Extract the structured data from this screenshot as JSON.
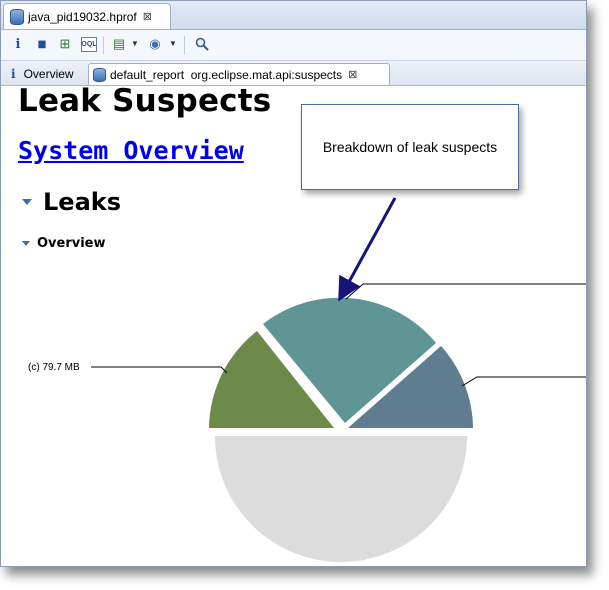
{
  "editor_tab": {
    "label": "java_pid19032.hprof",
    "close_glyph": "⊠"
  },
  "toolbar": {
    "buttons": [
      {
        "icon": "info-icon",
        "glyph": "i"
      },
      {
        "icon": "histogram-icon",
        "glyph": "▮▮"
      },
      {
        "icon": "dominator-tree-icon",
        "glyph": "⊞"
      },
      {
        "icon": "oql-icon",
        "glyph": "OQL"
      },
      {
        "icon": "run-report-icon",
        "glyph": "▤"
      },
      {
        "icon": "query-browser-icon",
        "glyph": "◉"
      },
      {
        "icon": "search-icon",
        "glyph": "🔍"
      }
    ]
  },
  "subtabs": {
    "overview": {
      "icon": "info-icon",
      "label": "Overview"
    },
    "report": {
      "icon": "report-icon",
      "label": "default_report  org.eclipse.mat.api:suspects",
      "close_glyph": "⊠"
    }
  },
  "report": {
    "title": "Leak Suspects",
    "system_overview_link": "System Overview",
    "leaks_heading": "Leaks",
    "overview_heading": "Overview"
  },
  "callout": {
    "text": "Breakdown of leak suspects"
  },
  "colors": {
    "slice_teal": "#5f9595",
    "slice_blue": "#5f7c90",
    "slice_green": "#6e8a4b",
    "slice_gray": "#dcdcdc",
    "link": "#0000ee",
    "arrow": "#14147a"
  },
  "chart_data": {
    "type": "pie",
    "slices": [
      {
        "label": "(c) 79.7 MB",
        "value": 79.7,
        "color": "#6e8a4b"
      },
      {
        "label": "",
        "value": null,
        "color": "#5f9595"
      },
      {
        "label": "",
        "value": null,
        "color": "#5f7c90"
      },
      {
        "label": "",
        "value": null,
        "color": "#dcdcdc"
      }
    ]
  }
}
